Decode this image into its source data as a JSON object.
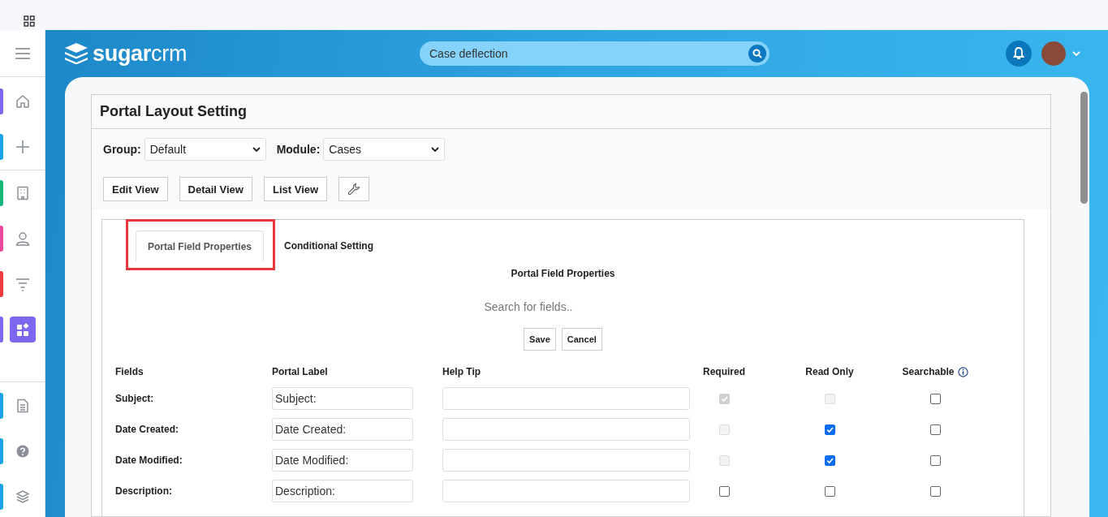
{
  "sidebar": {
    "items": [
      {
        "color": "#7b68ee",
        "selected": false
      },
      {
        "color": "#1aa3e8",
        "selected": false
      },
      {
        "color": "#14b87a",
        "selected": false
      },
      {
        "color": "#e9489a",
        "selected": false
      },
      {
        "color": "#ec3b3b",
        "selected": false
      },
      {
        "color": "#7b68ee",
        "selected": true
      },
      {
        "color": "#1aa3e8",
        "selected": false
      },
      {
        "color": "#1aa3e8",
        "selected": false
      },
      {
        "color": "#1aa3e8",
        "selected": false
      }
    ]
  },
  "header": {
    "logo": "**sugar**crm",
    "search": {
      "value": "Case deflection"
    }
  },
  "panel": {
    "title": "Portal Layout Setting",
    "filters": [
      {
        "label": "Group:",
        "value": "Default"
      },
      {
        "label": "Module:",
        "value": "Cases"
      }
    ],
    "view_buttons": [
      "Edit View",
      "Detail View",
      "List View"
    ],
    "tabs": [
      {
        "label": "Portal Field Properties",
        "selected": true,
        "highlighted": true
      },
      {
        "label": "Conditional Setting",
        "selected": false,
        "highlighted": false
      }
    ],
    "section_title": "Portal Field Properties",
    "search": {
      "placeholder": "Search for fields.."
    },
    "actions": [
      "Save",
      "Cancel"
    ],
    "table": {
      "columns": [
        "Fields",
        "Portal Label",
        "Help Tip",
        "Required",
        "Read Only",
        "Searchable"
      ],
      "rows": [
        {
          "field": "Subject:",
          "portal_label": "Subject:",
          "required": {
            "checked": true,
            "disabled": true
          },
          "read_only": {
            "checked": false,
            "disabled": true
          },
          "searchable": {
            "checked": false,
            "disabled": false
          }
        },
        {
          "field": "Date Created:",
          "portal_label": "Date Created:",
          "required": {
            "checked": false,
            "disabled": true
          },
          "read_only": {
            "checked": true,
            "disabled": false
          },
          "searchable": {
            "checked": false,
            "disabled": false
          }
        },
        {
          "field": "Date Modified:",
          "portal_label": "Date Modified:",
          "required": {
            "checked": false,
            "disabled": true
          },
          "read_only": {
            "checked": true,
            "disabled": false
          },
          "searchable": {
            "checked": false,
            "disabled": false
          }
        },
        {
          "field": "Description:",
          "portal_label": "Description:",
          "required": {
            "checked": false,
            "disabled": false
          },
          "read_only": {
            "checked": false,
            "disabled": false
          },
          "searchable": {
            "checked": false,
            "disabled": false
          }
        }
      ]
    }
  }
}
